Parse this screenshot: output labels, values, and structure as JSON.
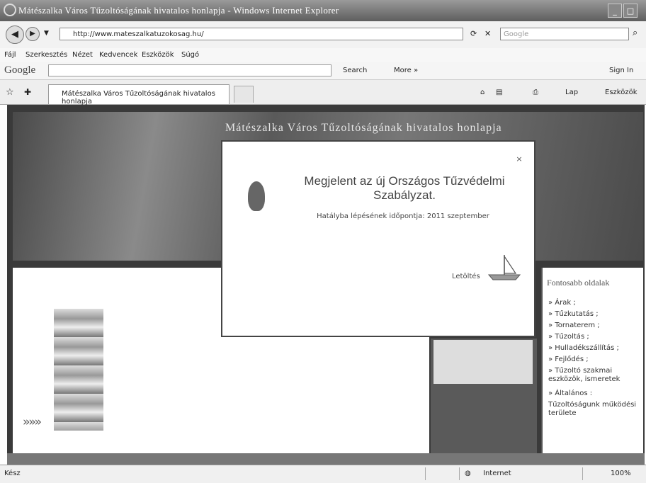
{
  "window": {
    "title": "Mátészalka Város Tűzoltóságának hivatalos honlapja - Windows Internet Explorer",
    "buttons": {
      "minimize": "_",
      "maximize": "□"
    }
  },
  "address_bar": {
    "url": "http://www.mateszalkatuzokosag.hu/",
    "search_placeholder": "Google"
  },
  "menu": [
    "Fájl",
    "Szerkesztés",
    "Nézet",
    "Kedvencek",
    "Eszközök",
    "Súgó"
  ],
  "google_toolbar": {
    "logo": "Google",
    "search_label": "Search",
    "more_label": "More »",
    "sign_in": "Sign In"
  },
  "tabs": {
    "active_tab": "Mátészalka Város Tűzoltóságának hivatalos honlapja",
    "tools": [
      "Lap",
      "Eszközök"
    ]
  },
  "page": {
    "banner_title": "Mátészalka Város Tűzoltóságának hivatalos honlapja",
    "arrows": "»»»",
    "side_heading": "Fontosabb oldalak",
    "side_links": [
      "» Árak ;",
      "» Tűzkutatás ;",
      "» Tornaterem ;",
      "» Tűzoltás ;",
      "» Hulladékszállítás ;",
      "» Fejlődés ;",
      "» Tűzoltó szakmai eszközök, ismeretek",
      "» Általános :",
      "Tűzoltóságunk működési területe"
    ]
  },
  "popup": {
    "close": "×",
    "title": "Megjelent az új Országos Tűzvédelmi Szabályzat.",
    "subtitle": "Hatályba lépésének időpontja: 2011 szeptember",
    "link": "Letöltés"
  },
  "status_bar": {
    "left_text": "Kész",
    "zone": "Internet",
    "zoom": "100%"
  }
}
